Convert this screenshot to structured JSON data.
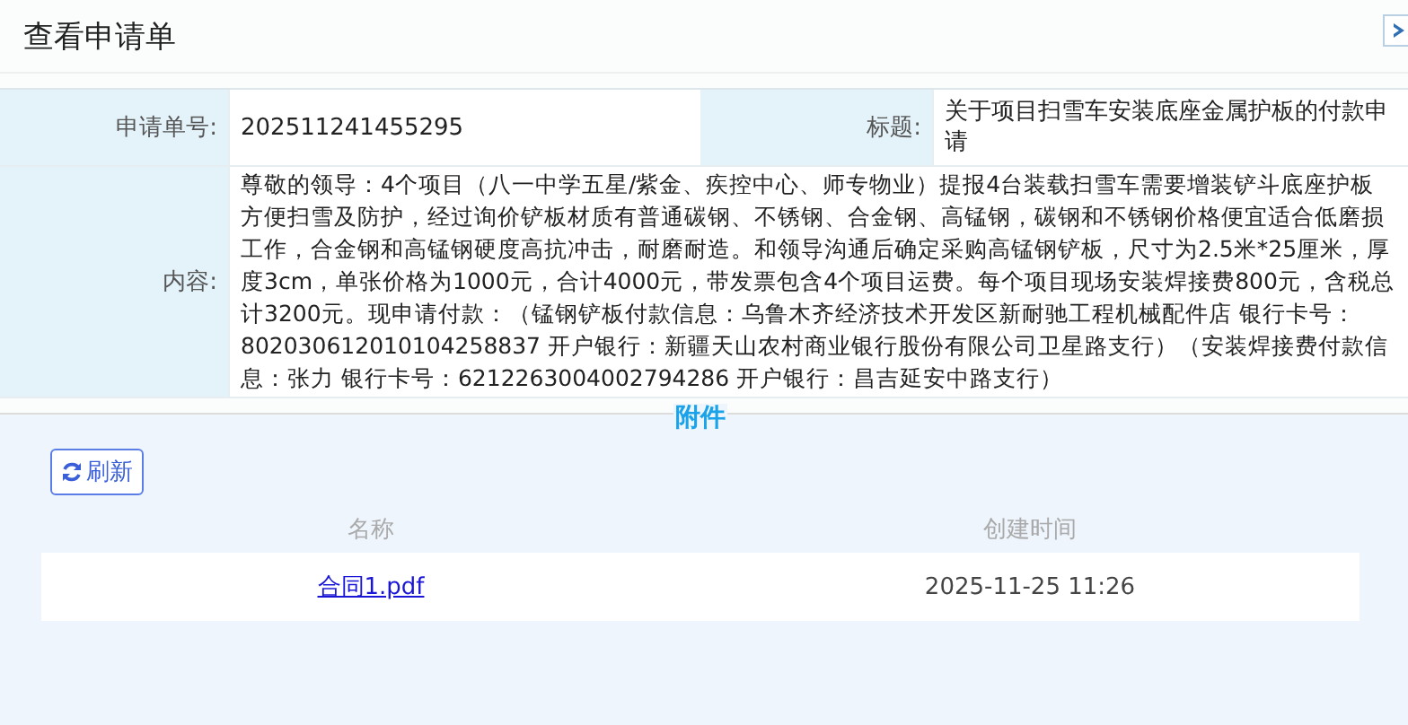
{
  "dialog": {
    "title": "查看申请单"
  },
  "fields": [
    {
      "label": "申请单号:",
      "value": "202511241455295"
    },
    {
      "label": "标题:",
      "value": "关于项目扫雪车安装底座金属护板的付款申请"
    },
    {
      "label": "内容:",
      "value": "尊敬的领导：4个项目（八一中学五星/紫金、疾控中心、师专物业）提报4台装载扫雪车需要增装铲斗底座护板方便扫雪及防护，经过询价铲板材质有普通碳钢、不锈钢、合金钢、高锰钢，碳钢和不锈钢价格便宜适合低磨损工作，合金钢和高锰钢硬度高抗冲击，耐磨耐造。和领导沟通后确定采购高锰钢铲板，尺寸为2.5米*25厘米，厚度3cm，单张价格为1000元，合计4000元，带发票包含4个项目运费。每个项目现场安装焊接费800元，含税总计3200元。现申请付款：（锰钢铲板付款信息：乌鲁木齐经济技术开发区新耐驰工程机械配件店 银行卡号：802030612010104258837 开户银行：新疆天山农村商业银行股份有限公司卫星路支行）（安装焊接费付款信息：张力 银行卡号：6212263004002794286 开户银行：昌吉延安中路支行）"
    }
  ],
  "attachments": {
    "title": "附件",
    "refresh_button": "刷新",
    "columns": [
      "名称",
      "创建时间"
    ],
    "rows": [
      {
        "name": "合同1.pdf",
        "created": "2025-11-25 11:26"
      }
    ]
  }
}
